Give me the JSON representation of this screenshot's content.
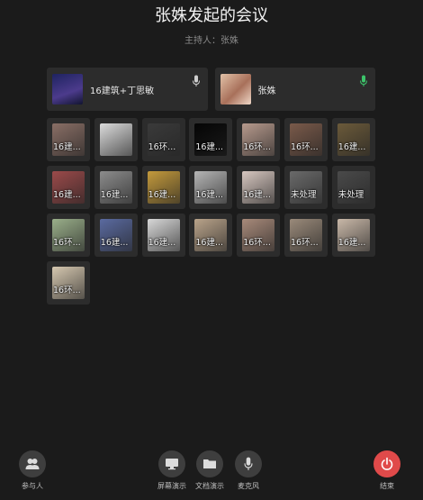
{
  "header": {
    "title": "张姝发起的会议",
    "subtitle": "主持人：张姝"
  },
  "host_cards": [
    {
      "name": "16建筑+丁思敏",
      "thumb_color": "#2a2f6e",
      "mic_color": "#cfcfcf",
      "icon": "mic-icon"
    },
    {
      "name": "张姝",
      "thumb_color": "#c9a58a",
      "mic_color": "#3cc46a",
      "icon": "mic-active-icon"
    }
  ],
  "participants": [
    {
      "label": "16建...",
      "thumb": "#8a6f66"
    },
    {
      "label": "",
      "thumb": "#dcdcdc"
    },
    {
      "label": "16环...",
      "thumb": "#3a3a3a"
    },
    {
      "label": "16建...",
      "thumb": "#050505"
    },
    {
      "label": "16环...",
      "thumb": "#b79a8d"
    },
    {
      "label": "16环...",
      "thumb": "#7a5a4a"
    },
    {
      "label": "16建...",
      "thumb": "#6b5a3a"
    },
    {
      "label": "16建...",
      "thumb": "#9b4a4a"
    },
    {
      "label": "16建...",
      "thumb": "#8c8c8c"
    },
    {
      "label": "16建...",
      "thumb": "#c49a3c"
    },
    {
      "label": "16建...",
      "thumb": "#b5b5b5"
    },
    {
      "label": "16建...",
      "thumb": "#d7c7c0"
    },
    {
      "label": "未处理",
      "thumb": "#6a6a6a"
    },
    {
      "label": "未处理",
      "thumb": "#4a4a4a"
    },
    {
      "label": "16环...",
      "thumb": "#9aaf8a"
    },
    {
      "label": "16建...",
      "thumb": "#5a6aa0"
    },
    {
      "label": "16建...",
      "thumb": "#d8d8d8"
    },
    {
      "label": "16建...",
      "thumb": "#b9a38a"
    },
    {
      "label": "16环...",
      "thumb": "#a88a7a"
    },
    {
      "label": "16环...",
      "thumb": "#9a8a7a"
    },
    {
      "label": "16建...",
      "thumb": "#c9b8a8"
    },
    {
      "label": "16环...",
      "thumb": "#d6c8b0"
    }
  ],
  "bottom_bar": {
    "participants": {
      "label": "参与人",
      "icon": "people-icon"
    },
    "screen_share": {
      "label": "屏幕演示",
      "icon": "screen-icon"
    },
    "doc_share": {
      "label": "文档演示",
      "icon": "folder-icon"
    },
    "microphone": {
      "label": "麦克风",
      "icon": "mic-icon"
    },
    "end": {
      "label": "结束",
      "icon": "power-icon",
      "color": "#e04a4a"
    }
  }
}
